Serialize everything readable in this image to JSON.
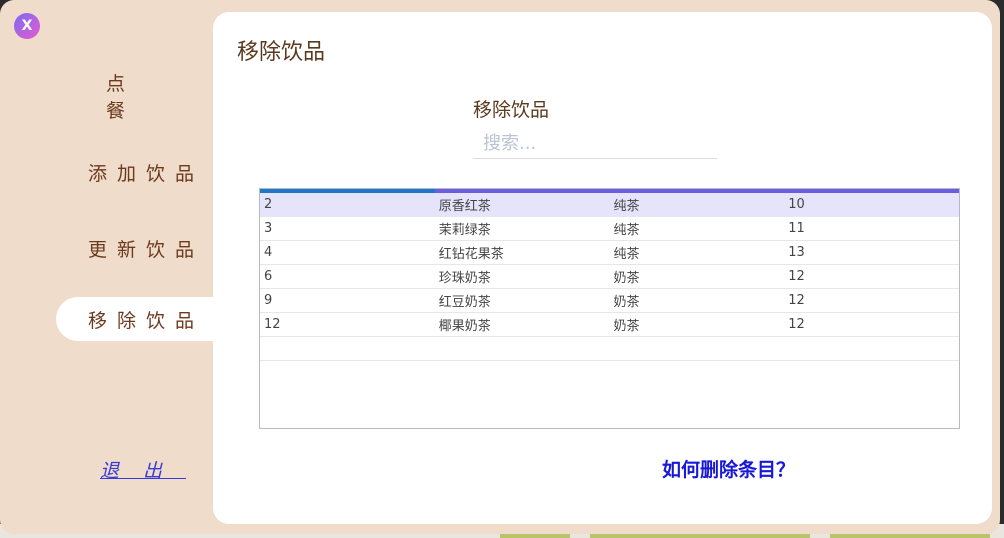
{
  "window": {
    "close_label": "X"
  },
  "sidebar": {
    "items": [
      {
        "label": "点餐",
        "active": false
      },
      {
        "label": "添加饮品",
        "active": false
      },
      {
        "label": "更新饮品",
        "active": false
      },
      {
        "label": "移除饮品",
        "active": true
      }
    ],
    "exit_label": "退出"
  },
  "panel": {
    "title": "移除饮品",
    "section_title": "移除饮品",
    "search": {
      "placeholder": "搜索...",
      "value": ""
    },
    "table": {
      "selected_row": 0,
      "rows": [
        [
          "2",
          "原香红茶",
          "纯茶",
          "10"
        ],
        [
          "3",
          "茉莉绿茶",
          "纯茶",
          "11"
        ],
        [
          "4",
          "红钻花果茶",
          "纯茶",
          "13"
        ],
        [
          "6",
          "珍珠奶茶",
          "奶茶",
          "12"
        ],
        [
          "9",
          "红豆奶茶",
          "奶茶",
          "12"
        ],
        [
          "12",
          "椰果奶茶",
          "奶茶",
          "12"
        ]
      ]
    },
    "help_link": "如何删除条目？"
  },
  "colors": {
    "window_bg": "#efdcca",
    "nav_text": "#6b3a1e",
    "link": "#1818d8",
    "selected_row": "#e6e4fb",
    "table_bar_left": "#1e78c8",
    "table_bar_right": "#6b5de0"
  }
}
